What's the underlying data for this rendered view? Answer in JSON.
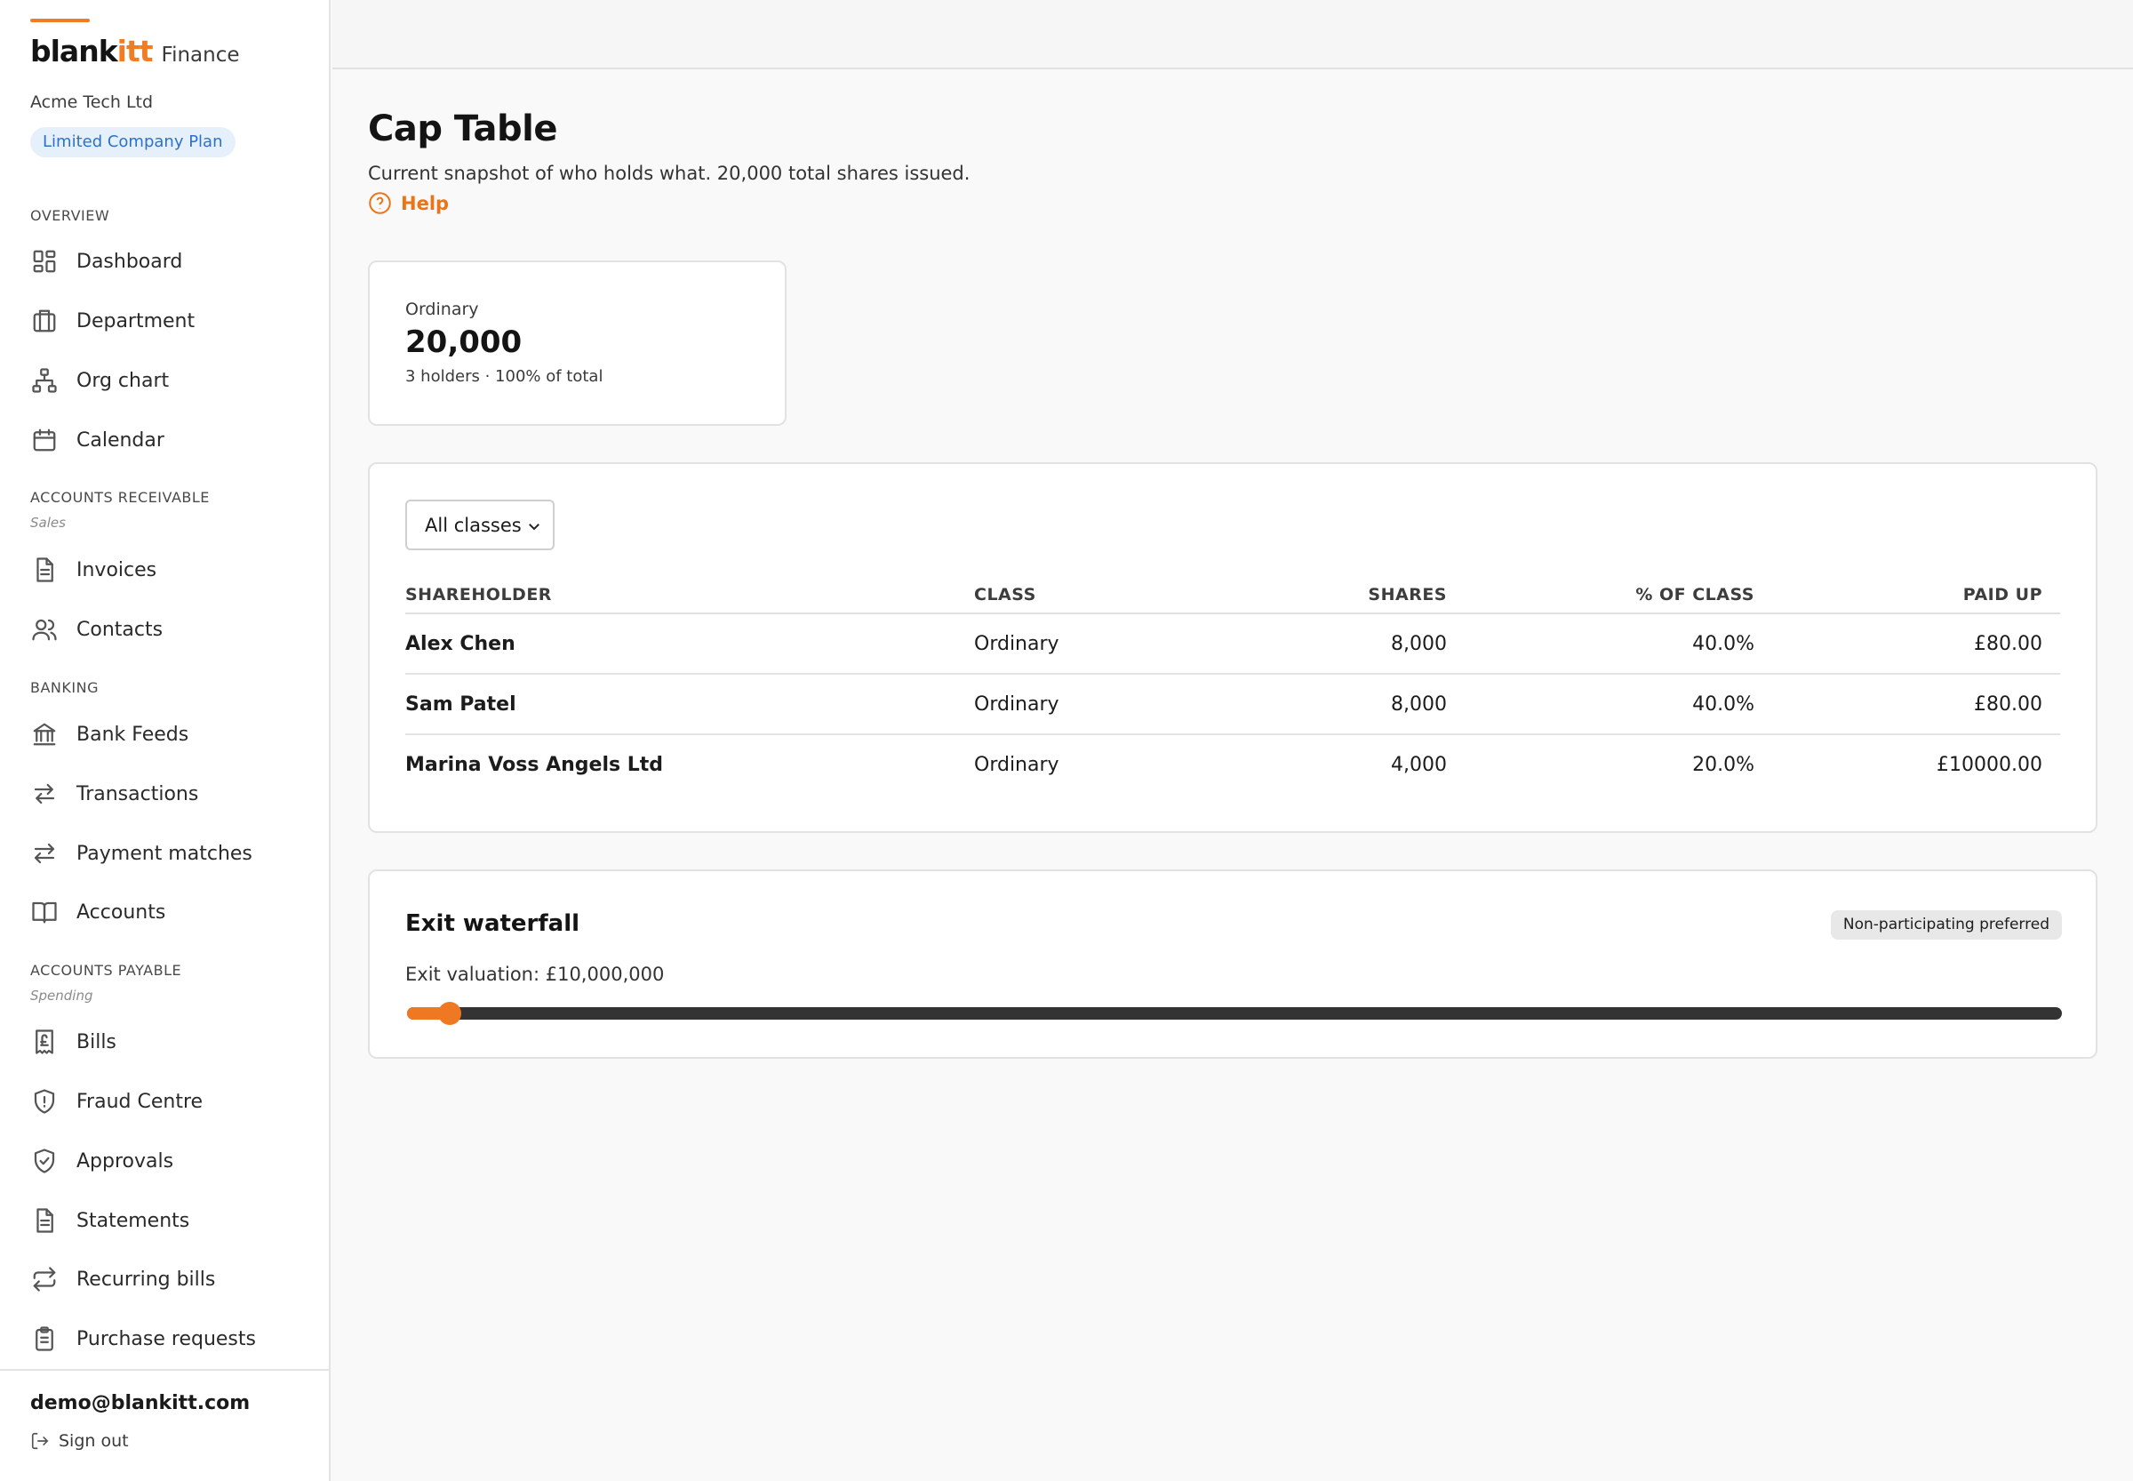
{
  "sidebar": {
    "brand": {
      "logo_main": "blank",
      "logo_accent": "itt",
      "product": "Finance"
    },
    "company": "Acme Tech Ltd",
    "plan": "Limited Company Plan",
    "sections": {
      "overview": "OVERVIEW",
      "receivable": "ACCOUNTS RECEIVABLE",
      "receivable_sub": "Sales",
      "banking": "BANKING",
      "payable": "ACCOUNTS PAYABLE",
      "payable_sub": "Spending"
    },
    "items": {
      "dashboard": "Dashboard",
      "department": "Department",
      "org_chart": "Org chart",
      "calendar": "Calendar",
      "invoices": "Invoices",
      "contacts": "Contacts",
      "bank_feeds": "Bank Feeds",
      "transactions": "Transactions",
      "payment_matches": "Payment matches",
      "accounts": "Accounts",
      "bills": "Bills",
      "fraud_centre": "Fraud Centre",
      "approvals": "Approvals",
      "statements": "Statements",
      "recurring_bills": "Recurring bills",
      "purchase_requests": "Purchase requests"
    },
    "user_email": "demo@blankitt.com",
    "sign_out": "Sign out"
  },
  "main": {
    "title": "Cap Table",
    "description": "Current snapshot of who holds what. 20,000 total shares issued.",
    "help": "Help",
    "stat": {
      "label": "Ordinary",
      "value": "20,000",
      "meta": "3 holders · 100% of total"
    },
    "filter": {
      "selected": "All classes"
    },
    "table": {
      "headers": {
        "holder": "SHAREHOLDER",
        "class": "CLASS",
        "shares": "SHARES",
        "pct": "% OF CLASS",
        "paid": "PAID UP"
      },
      "rows": [
        {
          "holder": "Alex Chen",
          "class": "Ordinary",
          "shares": "8,000",
          "pct": "40.0%",
          "paid": "£80.00"
        },
        {
          "holder": "Sam Patel",
          "class": "Ordinary",
          "shares": "8,000",
          "pct": "40.0%",
          "paid": "£80.00"
        },
        {
          "holder": "Marina Voss Angels Ltd",
          "class": "Ordinary",
          "shares": "4,000",
          "pct": "20.0%",
          "paid": "£10000.00"
        }
      ]
    },
    "waterfall": {
      "title": "Exit waterfall",
      "badge": "Non-participating preferred",
      "valuation_label": "Exit valuation: £10,000,000",
      "slider_fraction": 0.026
    }
  },
  "colors": {
    "accent": "#ef7822",
    "plan_badge_text": "#2d72c8",
    "plan_badge_bg": "#e6f0fb",
    "slider_track": "#333333"
  }
}
